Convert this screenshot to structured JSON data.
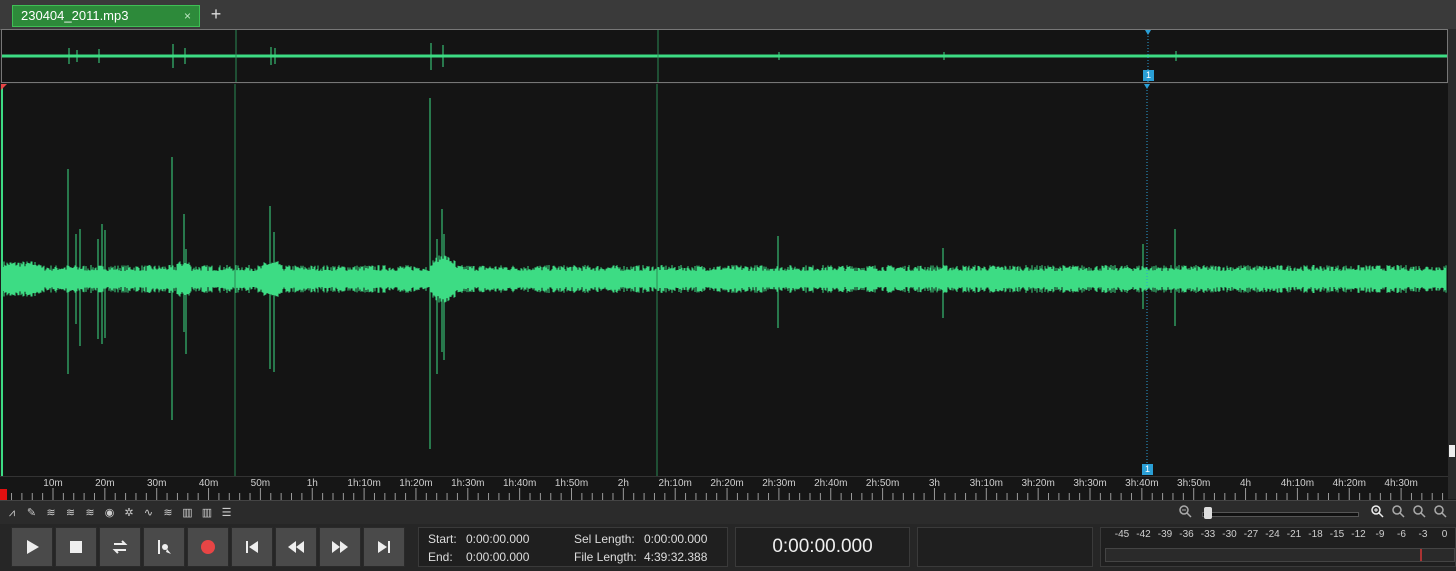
{
  "tab": {
    "title": "230404_2011.mp3",
    "close": "×",
    "add": "+"
  },
  "marker": {
    "label": "1"
  },
  "ruler": {
    "labels": [
      "10m",
      "20m",
      "30m",
      "40m",
      "50m",
      "1h",
      "1h:10m",
      "1h:20m",
      "1h:30m",
      "1h:40m",
      "1h:50m",
      "2h",
      "2h:10m",
      "2h:20m",
      "2h:30m",
      "2h:40m",
      "2h:50m",
      "3h",
      "3h:10m",
      "3h:20m",
      "3h:30m",
      "3h:40m",
      "3h:50m",
      "4h",
      "4h:10m",
      "4h:20m",
      "4h:30m"
    ]
  },
  "toolbar": {
    "tools": [
      "waveform-icon",
      "pencil-icon",
      "effect-1-icon",
      "effect-2-icon",
      "effect-3-icon",
      "effect-4-icon",
      "effect-5-icon",
      "effect-6-icon",
      "effect-7-icon",
      "spectrum-icon",
      "bars-icon",
      "list-icon"
    ]
  },
  "info": {
    "start_label": "Start:",
    "start_value": "0:00:00.000",
    "end_label": "End:",
    "end_value": "0:00:00.000",
    "sel_label": "Sel Length:",
    "sel_value": "0:00:00.000",
    "file_label": "File Length:",
    "file_value": "4:39:32.388"
  },
  "time_display": "0:00:00.000",
  "meter": {
    "labels": [
      "-45",
      "-42",
      "-39",
      "-36",
      "-33",
      "-30",
      "-27",
      "-24",
      "-21",
      "-18",
      "-15",
      "-12",
      "-9",
      "-6",
      "-3",
      "0"
    ]
  },
  "colors": {
    "waveform": "#3ddc84",
    "tab": "#2d8a3a",
    "marker": "#2a9fd6",
    "record": "#e84545"
  }
}
